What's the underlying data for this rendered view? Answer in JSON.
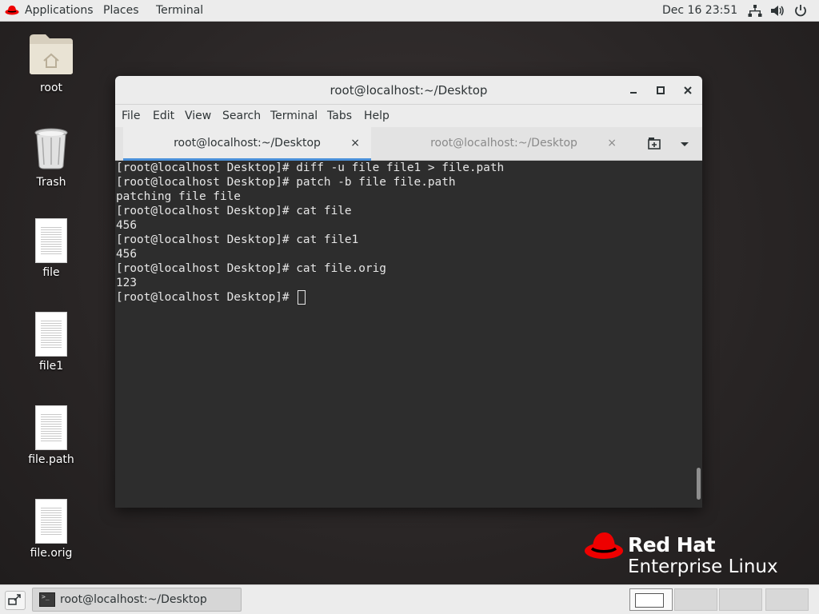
{
  "topbar": {
    "applications": "Applications",
    "places": "Places",
    "terminal": "Terminal",
    "clock": "Dec 16  23:51",
    "icons": [
      "network-icon",
      "volume-icon",
      "power-icon"
    ]
  },
  "desktop": {
    "icons": [
      {
        "label": "root",
        "kind": "home-folder-icon"
      },
      {
        "label": "Trash",
        "kind": "trash-icon"
      },
      {
        "label": "file",
        "kind": "document-icon"
      },
      {
        "label": "file1",
        "kind": "document-icon"
      },
      {
        "label": "file.path",
        "kind": "document-icon"
      },
      {
        "label": "file.orig",
        "kind": "document-icon"
      }
    ]
  },
  "window": {
    "title": "root@localhost:~/Desktop",
    "menu": [
      "File",
      "Edit",
      "View",
      "Search",
      "Terminal",
      "Tabs",
      "Help"
    ],
    "tabs": [
      {
        "label": "root@localhost:~/Desktop",
        "active": true
      },
      {
        "label": "root@localhost:~/Desktop",
        "active": false
      }
    ],
    "close_glyph": "×",
    "terminal_lines": [
      "[root@localhost Desktop]# diff -u file file1 > file.path",
      "[root@localhost Desktop]# patch -b file file.path",
      "patching file file",
      "[root@localhost Desktop]# cat file",
      "456",
      "[root@localhost Desktop]# cat file1",
      "456",
      "[root@localhost Desktop]# cat file.orig",
      "123"
    ],
    "prompt": "[root@localhost Desktop]# "
  },
  "brand": {
    "line1": "Red Hat",
    "line2": "Enterprise Linux",
    "color": "#ee0000"
  },
  "taskbar": {
    "task_label": "root@localhost:~/Desktop",
    "workspaces": 4,
    "active_workspace": 1
  }
}
